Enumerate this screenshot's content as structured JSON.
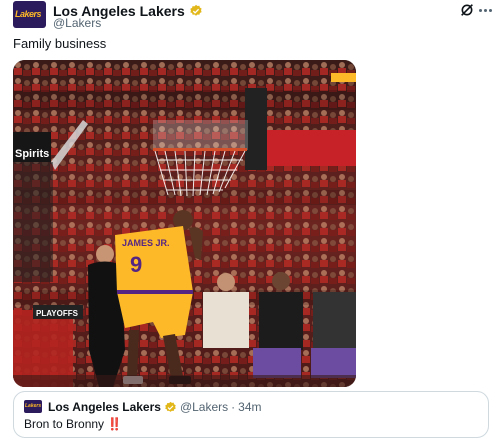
{
  "tweet": {
    "author_name": "Los Angeles Lakers",
    "author_handle": "@Lakers",
    "avatar_text": "Lakers",
    "text": "Family business"
  },
  "media": {
    "jersey_name": "JAMES JR.",
    "jersey_number": "9",
    "arena_sign": "Spirits",
    "playoffs_text": "PLAYOFFS",
    "colors": {
      "jersey": "#fdb927",
      "lakers_purple": "#552583",
      "crowd_red": "#b3231f"
    }
  },
  "quoted_tweet": {
    "author_name": "Los Angeles Lakers",
    "author_handle": "@Lakers",
    "separator": "·",
    "time": "34m",
    "text": "Bron to Bronny",
    "emoji": "‼️"
  },
  "icons": {
    "verified": "gold-verified-badge-icon",
    "grok": "grok-icon",
    "more": "more-dots-icon"
  }
}
